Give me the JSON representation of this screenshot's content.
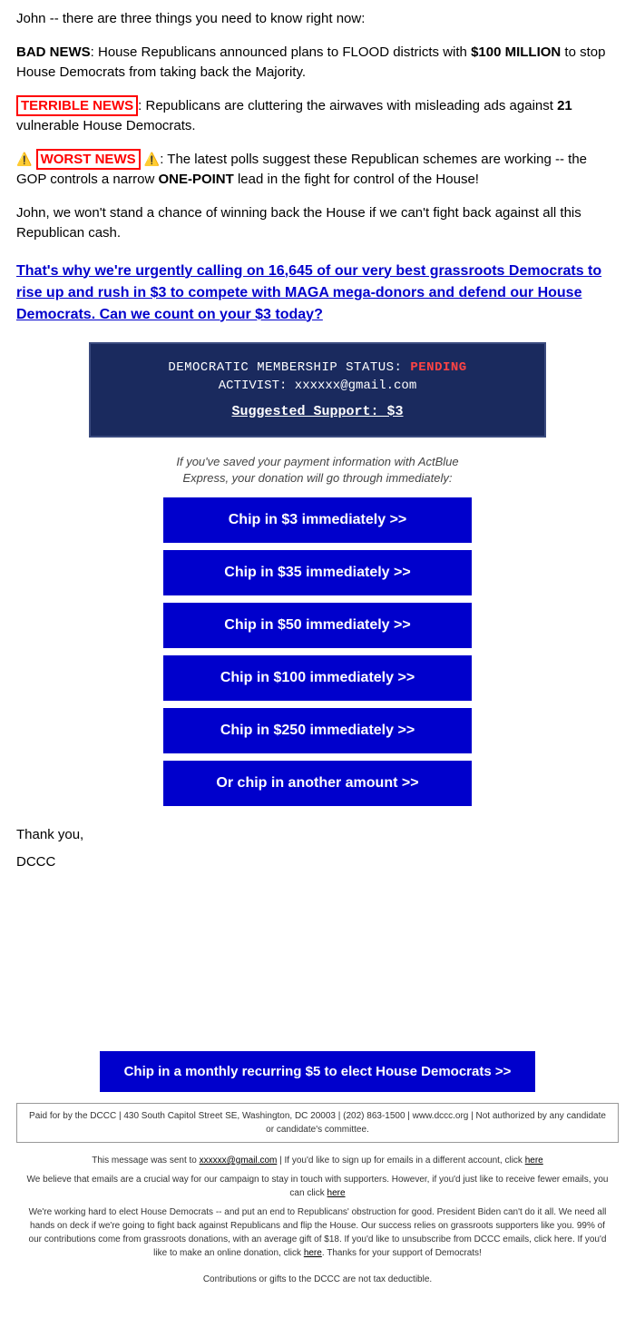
{
  "intro": {
    "text": "John -- there are three things you need to know right now:"
  },
  "bad_news": {
    "label": "BAD NEWS",
    "text": ": House Republicans announced plans to FLOOD districts with ",
    "amount": "$100 MILLION",
    "text2": " to stop House Democrats from taking back the Majority."
  },
  "terrible_news": {
    "label": "TERRIBLE NEWS",
    "text": ": Republicans are cluttering the airwaves with misleading ads against ",
    "number": "21",
    "text2": " vulnerable House Democrats."
  },
  "worst_news": {
    "icon": "⚠",
    "label": "WORST NEWS",
    "text": ": The latest polls suggest these Republican schemes are working -- the GOP controls a narrow ",
    "emphasis": "ONE-POINT",
    "text2": " lead in the fight for control of the House!"
  },
  "fight_back": {
    "text": "John, we won't stand a chance of winning back the House if we can't fight back against all this Republican cash."
  },
  "cta_link": {
    "text": "That's why we're urgently calling on 16,645 of our very best grassroots Democrats to rise up and rush in $3 to compete with MAGA mega-donors and defend our House Democrats. Can we count on your $3 today?"
  },
  "membership": {
    "status_label": "DEMOCRATIC MEMBERSHIP STATUS:",
    "status_value": "PENDING",
    "activist_label": "ACTIVIST:",
    "email": "xxxxxx@gmail.com",
    "suggested_label": "Suggested Support: $3"
  },
  "actblue_note": {
    "line1": "If you've saved your payment information with ActBlue",
    "line2": "Express, your donation will go through immediately:"
  },
  "buttons": {
    "btn1": "Chip in $3 immediately >>",
    "btn2": "Chip in $35 immediately >>",
    "btn3": "Chip in $50 immediately >>",
    "btn4": "Chip in $100 immediately >>",
    "btn5": "Chip in $250 immediately >>",
    "btn6": "Or chip in another amount >>"
  },
  "closing": {
    "thanks": "Thank you,",
    "signature": "DCCC"
  },
  "monthly_cta": {
    "label": "Chip in a monthly recurring $5 to elect House Democrats >>"
  },
  "paid_for": {
    "text": "Paid for by the DCCC | 430 South Capitol Street SE, Washington, DC 20003 | (202) 863-1500 | www.dccc.org | Not authorized by any candidate or candidate's committee."
  },
  "footer": {
    "sent_to_prefix": "This message was sent to ",
    "sent_to_email": "xxxxxx@gmail.com",
    "sent_to_suffix": " | If you'd like to sign up for emails in a different account, click ",
    "here1": "here",
    "line2": "We believe that emails are a crucial way for our campaign to stay in touch with supporters. However, if you'd just like to receive fewer emails, you can click ",
    "here2": "here",
    "line3": "We're working hard to elect House Democrats -- and put an end to Republicans' obstruction for good. President Biden can't do it all. We need all hands on deck if we're going to fight back against Republicans and flip the House. Our success relies on grassroots supporters like you. 99% of our contributions come from grassroots donations, with an average gift of $18. If you'd like to unsubscribe from DCCC emails, click here. If you'd like to make an online donation, click ",
    "here3": "here",
    "line3_suffix": ". Thanks for your support of Democrats!",
    "contributions_note": "Contributions or gifts to the DCCC are not tax deductible."
  }
}
